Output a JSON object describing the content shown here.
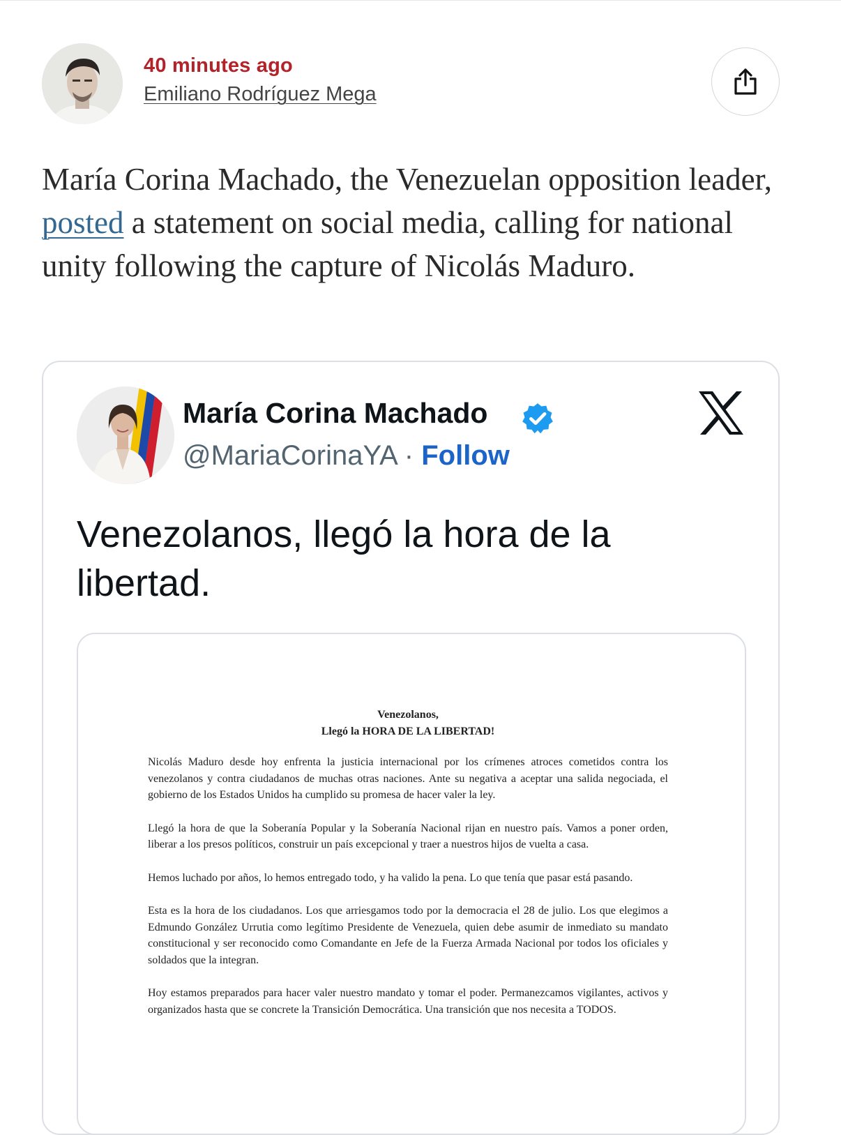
{
  "byline": {
    "timestamp": "40 minutes ago",
    "author": "Emiliano Rodríguez Mega",
    "share_icon": "share-icon"
  },
  "summary": {
    "before_link": "María Corina Machado, the Venezuelan opposition leader, ",
    "link_text": "posted",
    "after_link": " a statement on social media, calling for national unity following the capture of Nicolás Maduro."
  },
  "tweet": {
    "display_name": "María Corina Machado",
    "handle": "@MariaCorinaYA",
    "separator": "·",
    "follow_label": "Follow",
    "platform_icon": "x-logo-icon",
    "text": "Venezolanos, llegó la hora de la libertad."
  },
  "document": {
    "heading_line1": "Venezolanos,",
    "heading_line2": "Llegó la HORA DE LA LIBERTAD!",
    "paragraphs": [
      "Nicolás Maduro desde hoy enfrenta la justicia internacional por los crímenes atroces cometidos contra los venezolanos y contra ciudadanos de muchas otras naciones. Ante su negativa a aceptar una salida negociada, el gobierno de los Estados Unidos ha cumplido su promesa de hacer valer la ley.",
      "Llegó la hora de que la Soberanía Popular y la Soberanía Nacional rijan en nuestro país. Vamos a poner orden, liberar a los presos políticos, construir un país excepcional y traer a nuestros hijos de vuelta a casa.",
      "Hemos luchado por años, lo hemos entregado todo, y ha valido la pena. Lo que tenía que pasar está pasando.",
      "Esta es la hora de los ciudadanos. Los que arriesgamos todo por la democracia el 28 de julio. Los que elegimos a Edmundo González Urrutia como legítimo Presidente de Venezuela, quien debe asumir de inmediato su mandato constitucional y ser reconocido como Comandante en Jefe de la Fuerza Armada Nacional por todos los oficiales y soldados que la integran.",
      "Hoy estamos preparados para hacer valer nuestro mandato y tomar el poder. Permanezcamos vigilantes, activos y organizados hasta que se concrete la Transición Democrática. Una transición que nos necesita a TODOS."
    ]
  },
  "colors": {
    "timestamp": "#b3232a",
    "link": "#326891",
    "follow": "#1d64c9",
    "verified": "#1d9bf0"
  }
}
